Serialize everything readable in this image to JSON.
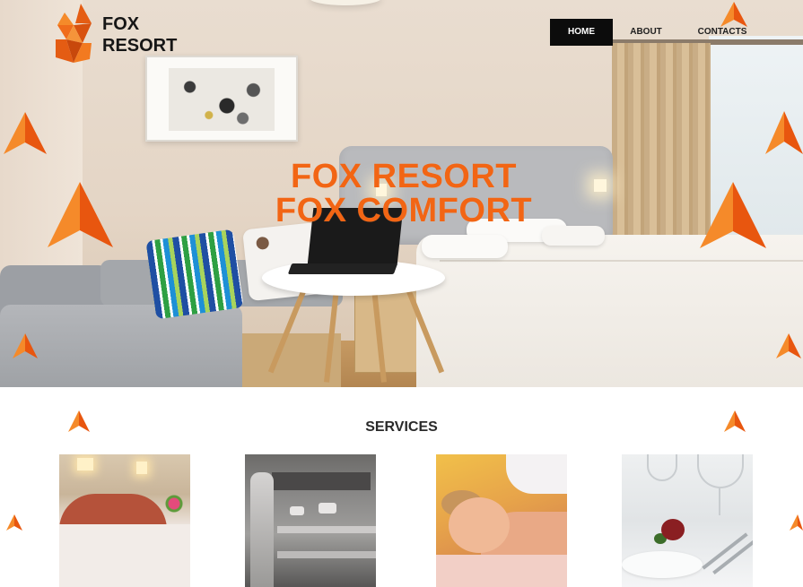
{
  "brand": {
    "name_line1": "FOX",
    "name_line2": "RESORT",
    "logo_icon": "fox-origami-icon"
  },
  "nav": {
    "items": [
      {
        "label": "HOME",
        "active": true
      },
      {
        "label": "ABOUT",
        "active": false
      },
      {
        "label": "CONTACTS",
        "active": false
      }
    ]
  },
  "hero": {
    "headline_line1": "FOX RESORT",
    "headline_line2": "FOX COMFORT",
    "image": "hotel-room-photo"
  },
  "services": {
    "title": "SERVICES",
    "cards": [
      {
        "image": "hotel-bedroom-photo"
      },
      {
        "image": "restaurant-kitchen-photo"
      },
      {
        "image": "spa-massage-photo"
      },
      {
        "image": "fine-dining-table-photo"
      }
    ]
  },
  "colors": {
    "accent": "#f26514",
    "nav_active_bg": "#0c0c0c",
    "text_dark": "#161616",
    "background": "#ffffff"
  },
  "decorations": {
    "marker_icon": "orange-triangle-arrow-icon"
  }
}
